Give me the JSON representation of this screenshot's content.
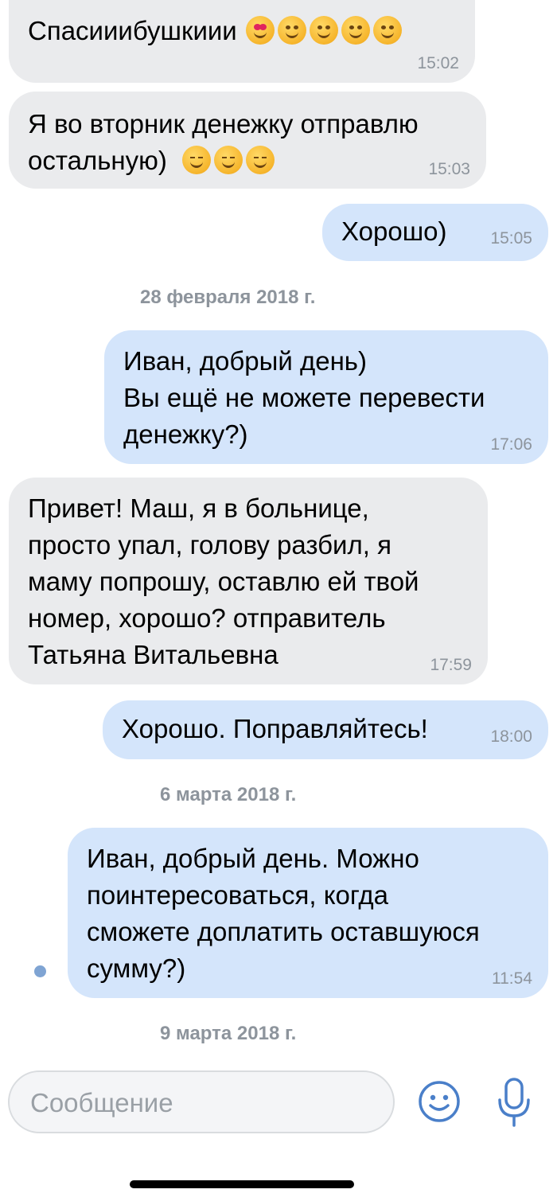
{
  "messages": [
    {
      "text": "Спасииибушкиии",
      "time": "15:02",
      "emoji": [
        "heart-eyes",
        "wink",
        "smile",
        "smile",
        "smile"
      ]
    },
    {
      "text": "Я во вторник денежку отправлю\nостальную)",
      "time": "15:03",
      "emoji": [
        "relieved",
        "relieved",
        "relieved"
      ]
    },
    {
      "text": "Хорошо)",
      "time": "15:05"
    },
    {
      "text": "Иван, добрый день)\nВы ещё не можете перевести\nденежку?)",
      "time": "17:06"
    },
    {
      "text": "Привет! Маш, я в больнице,\nпросто упал, голову разбил, я\nмаму попрошу, оставлю ей твой\nномер, хорошо? отправитель\nТатьяна Витальевна",
      "time": "17:59"
    },
    {
      "text": "Хорошо. Поправляйтесь!",
      "time": "18:00"
    },
    {
      "text": "Иван, добрый день. Можно\nпоинтересоваться, когда\nсможете доплатить оставшуюся\nсумму?)",
      "time": "11:54"
    }
  ],
  "dates": [
    "28 февраля 2018 г.",
    "6 марта 2018 г.",
    "9 марта 2018 г."
  ],
  "composer": {
    "placeholder": "Сообщение"
  },
  "icons": {
    "emoji_button": "smiley-icon",
    "voice_button": "microphone-icon"
  },
  "colors": {
    "incoming": "#eaebed",
    "outgoing": "#d4e5fb",
    "accent": "#4a7fc9",
    "muted": "#8d949c"
  }
}
